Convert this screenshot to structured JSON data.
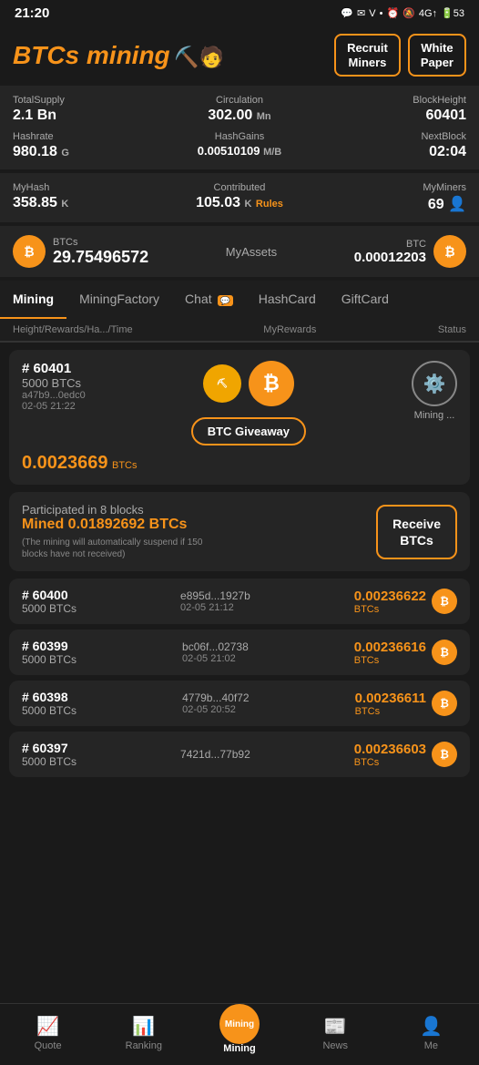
{
  "statusBar": {
    "time": "21:20",
    "icons": [
      "📱",
      "🔔",
      "4G",
      "🔋"
    ]
  },
  "header": {
    "logo": "BTCs mining",
    "logoEmoji": "⛏️",
    "recruitBtn": "Recruit\nMiners",
    "whitePaperBtn": "White\nPaper"
  },
  "stats": {
    "totalSupply": {
      "label": "TotalSupply",
      "value": "2.1 Bn"
    },
    "circulation": {
      "label": "Circulation",
      "value": "302.00",
      "unit": "Mn"
    },
    "blockHeight": {
      "label": "BlockHeight",
      "value": "60401"
    },
    "hashrate": {
      "label": "Hashrate",
      "value": "980.18",
      "unit": "G"
    },
    "hashGains": {
      "label": "HashGains",
      "value": "0.00510109",
      "unit": "M/B"
    },
    "nextBlock": {
      "label": "NextBlock",
      "value": "02:04"
    }
  },
  "myStats": {
    "myHash": {
      "label": "MyHash",
      "value": "358.85",
      "unit": "K"
    },
    "contributed": {
      "label": "Contributed",
      "value": "105.03",
      "unit": "K",
      "rulesLabel": "Rules"
    },
    "myMiners": {
      "label": "MyMiners",
      "value": "69"
    }
  },
  "assets": {
    "btcsLabel": "BTCs",
    "btcsValue": "29.75496572",
    "myAssetsLabel": "MyAssets",
    "btcLabel": "BTC",
    "btcValue": "0.00012203"
  },
  "tabs": [
    {
      "label": "Mining",
      "active": true
    },
    {
      "label": "MiningFactory",
      "active": false
    },
    {
      "label": "Chat",
      "active": false,
      "badge": "💬"
    },
    {
      "label": "HashCard",
      "active": false
    },
    {
      "label": "GiftCard",
      "active": false
    }
  ],
  "subHeader": {
    "left": "Height/Rewards/Ha.../Time",
    "mid": "MyRewards",
    "right": "Status"
  },
  "miningCard": {
    "blockNum": "# 60401",
    "btcsAmount": "5000 BTCs",
    "hash": "a47b9...0edc0",
    "time": "02-05 21:22",
    "miningAmount": "0.0023669",
    "miningUnit": "BTCs",
    "giveawayBtn": "BTC Giveaway",
    "miningStatus": "Mining ..."
  },
  "participated": {
    "label": "Participated in 8 blocks",
    "minedLabel": "Mined 0.01892692 BTCs",
    "note": "(The mining will automatically suspend if 150 blocks have not received)",
    "receiveBtn": "Receive\nBTCs"
  },
  "blockList": [
    {
      "blockNum": "# 60400",
      "btcsAmount": "5000 BTCs",
      "hash": "e895d...1927b",
      "time": "02-05 21:12",
      "reward": "0.00236622",
      "unit": "BTCs"
    },
    {
      "blockNum": "# 60399",
      "btcsAmount": "5000 BTCs",
      "hash": "bc06f...02738",
      "time": "02-05 21:02",
      "reward": "0.00236616",
      "unit": "BTCs"
    },
    {
      "blockNum": "# 60398",
      "btcsAmount": "5000 BTCs",
      "hash": "4779b...40f72",
      "time": "02-05 20:52",
      "reward": "0.00236611",
      "unit": "BTCs"
    },
    {
      "blockNum": "# 60397",
      "btcsAmount": "5000 BTCs",
      "hash": "7421d...77b92",
      "time": "",
      "reward": "0.00236603",
      "unit": "BTCs"
    }
  ],
  "bottomNav": [
    {
      "label": "Quote",
      "icon": "📈",
      "active": false
    },
    {
      "label": "Ranking",
      "icon": "📊",
      "active": false
    },
    {
      "label": "Mining",
      "icon": "⛏️",
      "active": true,
      "center": true
    },
    {
      "label": "News",
      "icon": "📰",
      "active": false
    },
    {
      "label": "Me",
      "icon": "👤",
      "active": false
    }
  ]
}
